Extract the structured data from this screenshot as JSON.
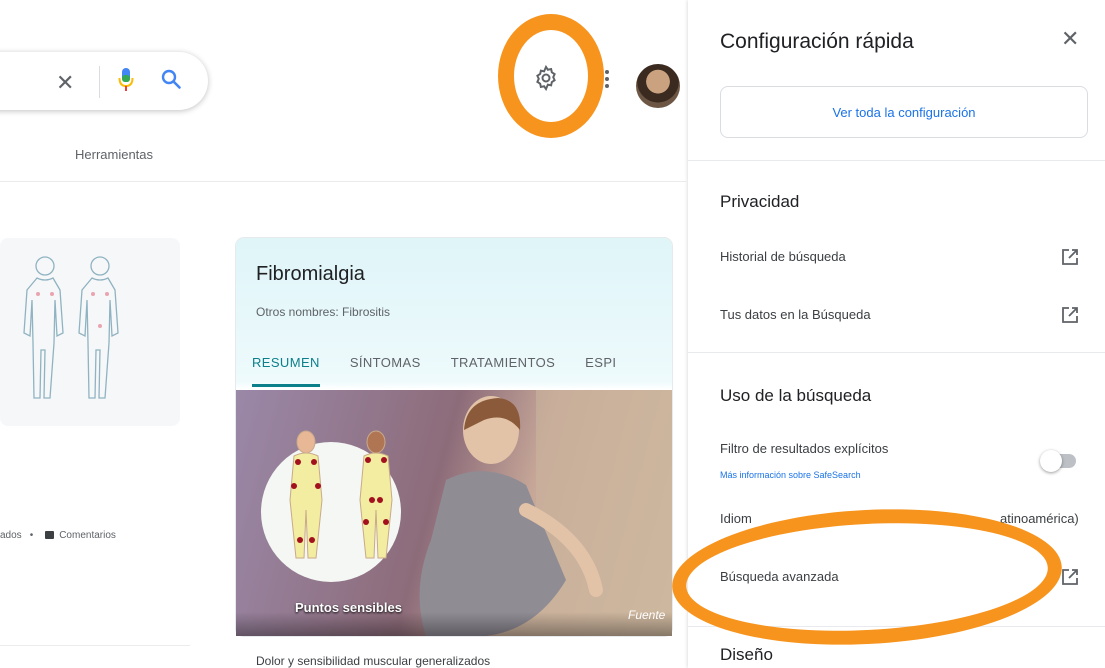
{
  "search": {
    "clear_icon": "close-icon",
    "voice_icon": "microphone-icon",
    "search_icon": "search-icon"
  },
  "nav": {
    "tools_label": "Herramientas"
  },
  "header": {
    "settings_icon": "gear-icon",
    "apps_icon": "more-vert-icon",
    "account_icon": "avatar"
  },
  "results": {
    "feedback_prefix": "ados",
    "feedback_dot": "•",
    "feedback_label": "Comentarios"
  },
  "knowledge_panel": {
    "title": "Fibromialgia",
    "subtitle": "Otros nombres: Fibrositis",
    "tabs": [
      "RESUMEN",
      "SÍNTOMAS",
      "TRATAMIENTOS",
      "ESPI"
    ],
    "active_tab": "RESUMEN",
    "image_label": "Puntos sensibles",
    "image_source": "Fuente",
    "description": "Dolor y sensibilidad muscular generalizados"
  },
  "quick_settings": {
    "title": "Configuración rápida",
    "see_all": "Ver toda la configuración",
    "privacy_heading": "Privacidad",
    "search_history": "Historial de búsqueda",
    "your_data": "Tus datos en la Búsqueda",
    "usage_heading": "Uso de la búsqueda",
    "explicit_filter": "Filtro de resultados explícitos",
    "safesearch_link": "Más información sobre SafeSearch",
    "explicit_filter_on": false,
    "language_prefix": "Idiom",
    "language_suffix": "atinoamérica)",
    "advanced_search": "Búsqueda avanzada",
    "appearance_heading": "Diseño"
  },
  "colors": {
    "accent": "#1a73e8",
    "highlight": "#f7941d",
    "tab_active": "#0b7f8a"
  }
}
